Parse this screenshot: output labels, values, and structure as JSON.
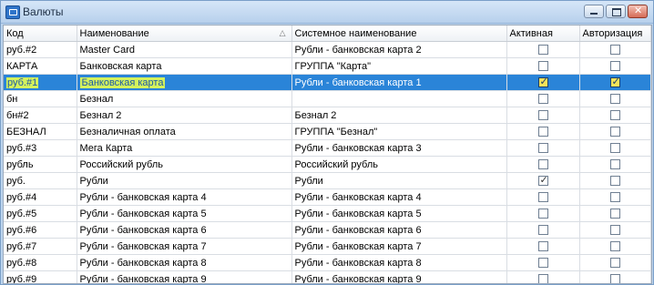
{
  "window": {
    "title": "Валюты"
  },
  "columns": {
    "code": "Код",
    "name": "Наименование",
    "system_name": "Системное наименование",
    "active": "Активная",
    "auth": "Авторизация"
  },
  "rows": [
    {
      "code": "руб.#2",
      "name": "Master Card",
      "system_name": "Рубли - банковская карта 2",
      "active": false,
      "auth": false,
      "selected": false
    },
    {
      "code": "КАРТА",
      "name": "Банковская карта",
      "system_name": "ГРУППА \"Карта\"",
      "active": false,
      "auth": false,
      "selected": false
    },
    {
      "code": "руб.#1",
      "name": "Банковская карта",
      "system_name": "Рубли - банковская карта 1",
      "active": true,
      "auth": true,
      "selected": true
    },
    {
      "code": "бн",
      "name": "Безнал",
      "system_name": "",
      "active": false,
      "auth": false,
      "selected": false
    },
    {
      "code": "бн#2",
      "name": "Безнал 2",
      "system_name": "Безнал 2",
      "active": false,
      "auth": false,
      "selected": false
    },
    {
      "code": "БЕЗНАЛ",
      "name": "Безналичная оплата",
      "system_name": "ГРУППА \"Безнал\"",
      "active": false,
      "auth": false,
      "selected": false
    },
    {
      "code": "руб.#3",
      "name": "Мега Карта",
      "system_name": "Рубли - банковская карта 3",
      "active": false,
      "auth": false,
      "selected": false
    },
    {
      "code": "рубль",
      "name": "Российский рубль",
      "system_name": "Российский рубль",
      "active": false,
      "auth": false,
      "selected": false
    },
    {
      "code": "руб.",
      "name": "Рубли",
      "system_name": "Рубли",
      "active": true,
      "auth": false,
      "selected": false
    },
    {
      "code": "руб.#4",
      "name": "Рубли - банковская карта 4",
      "system_name": "Рубли - банковская карта 4",
      "active": false,
      "auth": false,
      "selected": false
    },
    {
      "code": "руб.#5",
      "name": "Рубли - банковская карта 5",
      "system_name": "Рубли - банковская карта 5",
      "active": false,
      "auth": false,
      "selected": false
    },
    {
      "code": "руб.#6",
      "name": "Рубли - банковская карта 6",
      "system_name": "Рубли - банковская карта 6",
      "active": false,
      "auth": false,
      "selected": false
    },
    {
      "code": "руб.#7",
      "name": "Рубли - банковская карта 7",
      "system_name": "Рубли - банковская карта 7",
      "active": false,
      "auth": false,
      "selected": false
    },
    {
      "code": "руб.#8",
      "name": "Рубли - банковская карта 8",
      "system_name": "Рубли - банковская карта 8",
      "active": false,
      "auth": false,
      "selected": false
    },
    {
      "code": "руб.#9",
      "name": "Рубли - банковская карта 9",
      "system_name": "Рубли - банковская карта 9",
      "active": false,
      "auth": false,
      "selected": false
    }
  ],
  "colors": {
    "selected_row": "#2a84d8",
    "highlight": "#d4f25c"
  }
}
